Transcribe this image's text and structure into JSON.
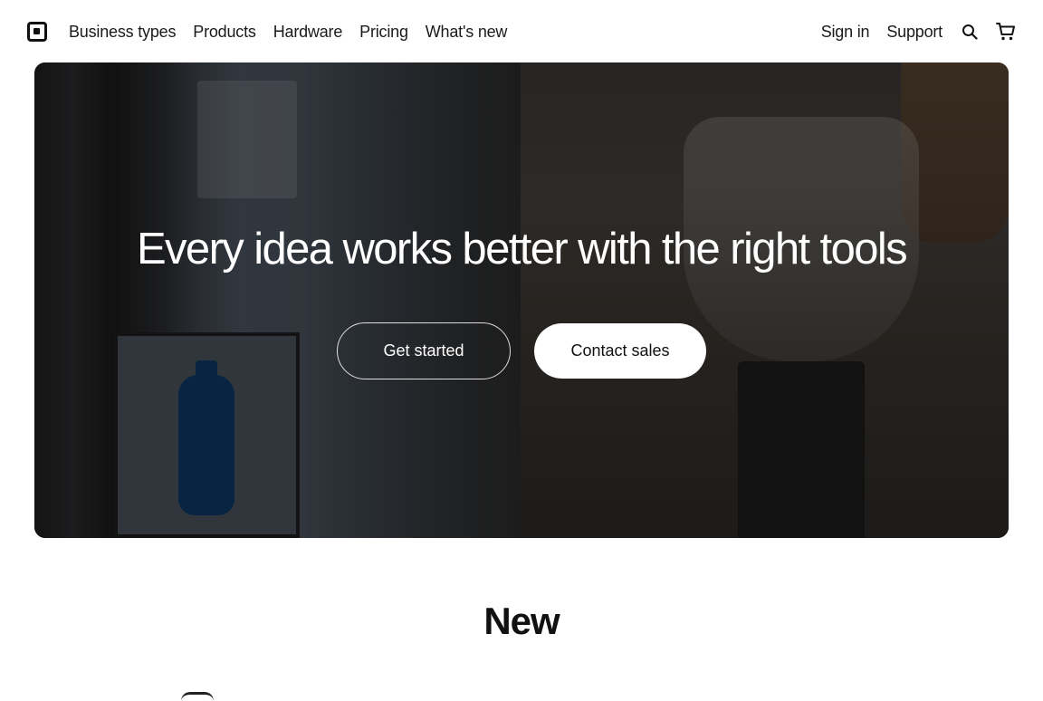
{
  "nav": {
    "links": [
      "Business types",
      "Products",
      "Hardware",
      "Pricing",
      "What's new"
    ],
    "right_links": [
      "Sign in",
      "Support"
    ],
    "icons": [
      "logo-icon",
      "search-icon",
      "cart-icon"
    ]
  },
  "hero": {
    "title": "Every idea works better with the right tools",
    "primary_button": "Get started",
    "secondary_button": "Contact sales"
  },
  "section": {
    "title": "New"
  },
  "colors": {
    "text": "#1a1a1a",
    "background": "#ffffff",
    "hero_text": "#ffffff"
  }
}
